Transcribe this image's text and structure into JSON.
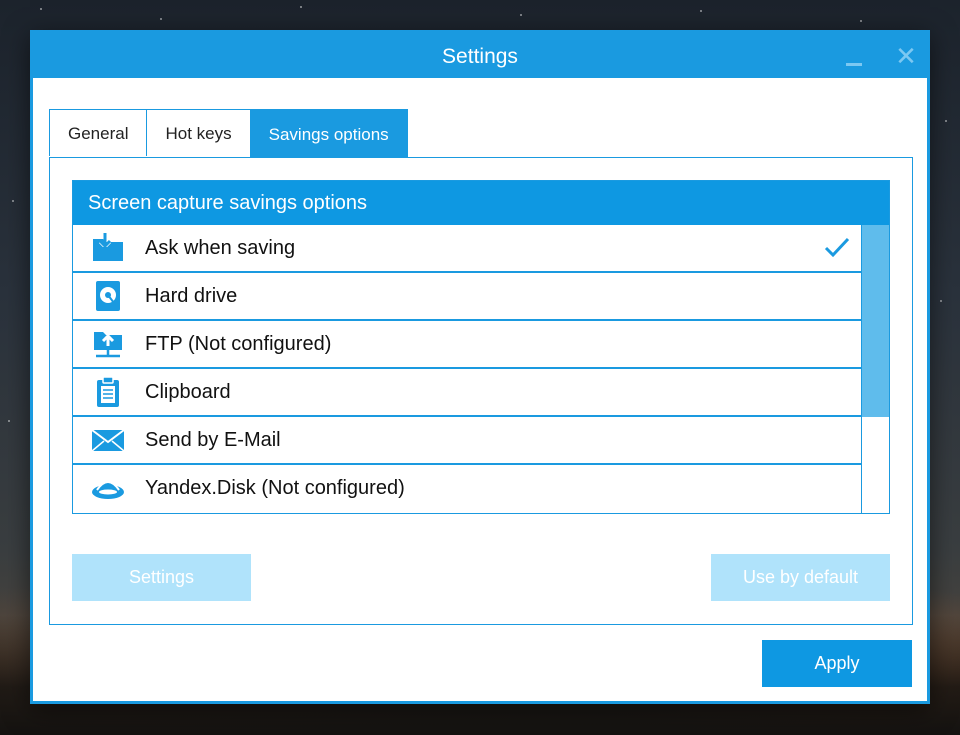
{
  "window": {
    "title": "Settings"
  },
  "tabs": [
    {
      "label": "General",
      "active": false
    },
    {
      "label": "Hot keys",
      "active": false
    },
    {
      "label": "Savings options",
      "active": true
    }
  ],
  "savings": {
    "header": "Screen capture savings options",
    "options": [
      {
        "label": "Ask when saving",
        "icon": "folder-download-icon",
        "selected": true
      },
      {
        "label": "Hard drive",
        "icon": "hard-drive-icon",
        "selected": false
      },
      {
        "label": "FTP (Not configured)",
        "icon": "ftp-folder-icon",
        "selected": false
      },
      {
        "label": "Clipboard",
        "icon": "clipboard-icon",
        "selected": false
      },
      {
        "label": "Send by E-Mail",
        "icon": "mail-icon",
        "selected": false
      },
      {
        "label": "Yandex.Disk (Not configured)",
        "icon": "yandex-disk-icon",
        "selected": false
      }
    ]
  },
  "buttons": {
    "settings": "Settings",
    "use_default": "Use by default",
    "apply": "Apply"
  },
  "colors": {
    "accent": "#1a9ae0",
    "header": "#0e98e2",
    "disabled": "#b0e3fb",
    "scroll_thumb": "#5fbcec"
  }
}
